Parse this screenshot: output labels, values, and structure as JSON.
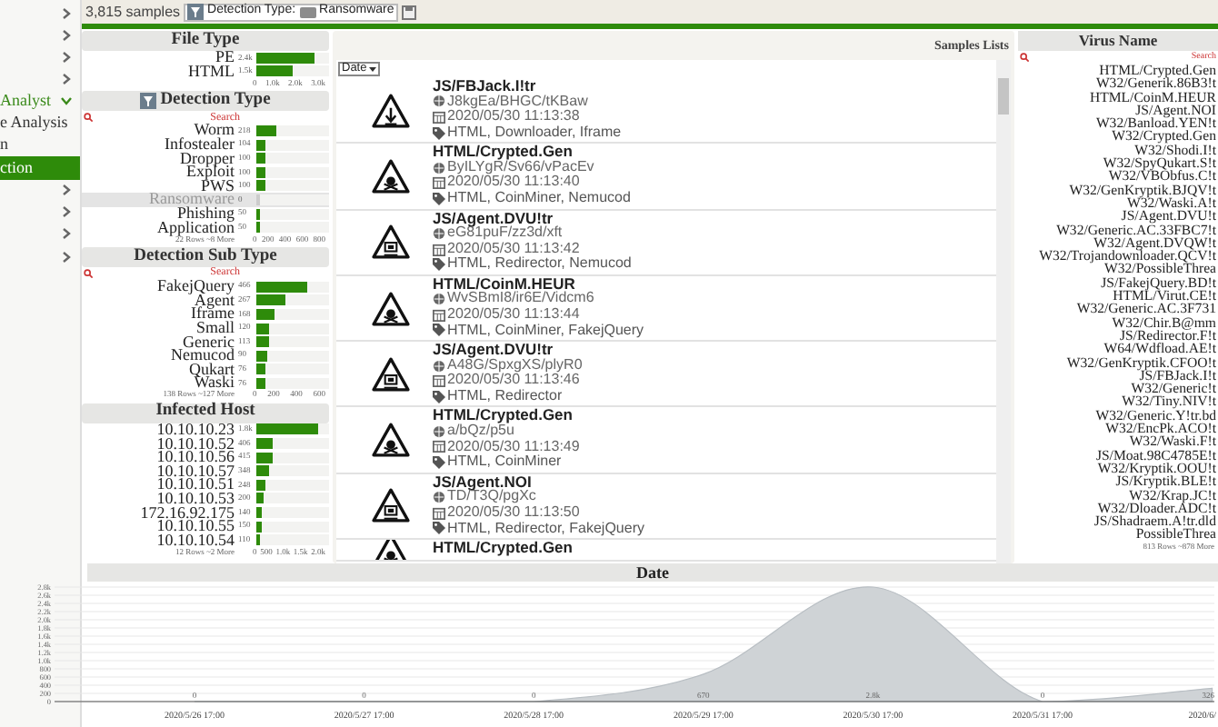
{
  "sidebar": {
    "items": [
      {
        "selected": false
      },
      {
        "selected": false
      },
      {
        "selected": false
      },
      {
        "selected": false
      },
      {
        "label": "Analyst",
        "expanded": true,
        "selected": false
      },
      {
        "label": "e Analysis",
        "selected": false
      },
      {
        "label": "n",
        "selected": false
      },
      {
        "label": "ction",
        "selected": true
      },
      {
        "selected": false
      },
      {
        "selected": false
      },
      {
        "selected": false
      },
      {
        "selected": false
      }
    ]
  },
  "toolbar": {
    "count": "3,815 samples",
    "filter": {
      "label": "Detection Type:",
      "value": "Ransomware"
    }
  },
  "facets": [
    {
      "title": "File Type",
      "rows": [
        {
          "label": "PE",
          "reading": "2.4k",
          "level": 0.8
        },
        {
          "label": "HTML",
          "reading": "1.5k",
          "level": 0.5
        }
      ],
      "ticks": [
        "0",
        "1.0k",
        "2.0k",
        "3.0k"
      ]
    },
    {
      "title": "Detection Type",
      "filtered": true,
      "search": "Search",
      "rows": [
        {
          "label": "Worm",
          "reading": "218",
          "level": 0.27,
          "disabled": false
        },
        {
          "label": "Infostealer",
          "reading": "104",
          "level": 0.13,
          "disabled": false
        },
        {
          "label": "Dropper",
          "reading": "100",
          "level": 0.12,
          "disabled": false
        },
        {
          "label": "Exploit",
          "reading": "100",
          "level": 0.12,
          "disabled": false
        },
        {
          "label": "PWS",
          "reading": "100",
          "level": 0.12,
          "disabled": false
        },
        {
          "label": "Ransomware",
          "reading": "0",
          "level": 0.04,
          "disabled": true
        },
        {
          "label": "Phishing",
          "reading": "50",
          "level": 0.06,
          "disabled": false
        },
        {
          "label": "Application",
          "reading": "50",
          "level": 0.06,
          "disabled": false
        }
      ],
      "footer": "22 Rows ~8 More",
      "ticks": [
        "0",
        "200",
        "400",
        "600",
        "800"
      ]
    },
    {
      "title": "Detection Sub Type",
      "search": "Search",
      "rows": [
        {
          "label": "FakejQuery",
          "reading": "466",
          "level": 0.7
        },
        {
          "label": "Agent",
          "reading": "267",
          "level": 0.4
        },
        {
          "label": "Iframe",
          "reading": "168",
          "level": 0.26
        },
        {
          "label": "Small",
          "reading": "120",
          "level": 0.18
        },
        {
          "label": "Generic",
          "reading": "113",
          "level": 0.17
        },
        {
          "label": "Nemucod",
          "reading": "90",
          "level": 0.14
        },
        {
          "label": "Qukart",
          "reading": "76",
          "level": 0.12
        },
        {
          "label": "Waski",
          "reading": "76",
          "level": 0.12
        }
      ],
      "footer": "138 Rows ~127 More",
      "ticks": [
        "0",
        "200",
        "400",
        "600"
      ]
    },
    {
      "title": "Infected Host",
      "rows": [
        {
          "label": "10.10.10.23",
          "reading": "1.8k",
          "level": 0.85
        },
        {
          "label": "10.10.10.52",
          "reading": "406",
          "level": 0.22
        },
        {
          "label": "10.10.10.56",
          "reading": "415",
          "level": 0.22
        },
        {
          "label": "10.10.10.57",
          "reading": "348",
          "level": 0.18
        },
        {
          "label": "10.10.10.51",
          "reading": "248",
          "level": 0.13
        },
        {
          "label": "10.10.10.53",
          "reading": "200",
          "level": 0.11
        },
        {
          "label": "172.16.92.175",
          "reading": "140",
          "level": 0.08
        },
        {
          "label": "10.10.10.55",
          "reading": "150",
          "level": 0.08
        },
        {
          "label": "10.10.10.54",
          "reading": "110",
          "level": 0.06
        }
      ],
      "footer": "12 Rows ~2 More",
      "ticks": [
        "0",
        "500",
        "1.0k",
        "1.5k",
        "2.0k"
      ]
    }
  ],
  "samples": {
    "title": "Samples Lists",
    "sort": "Date",
    "items": [
      {
        "kind": "download",
        "name": "JS/FBJack.I!tr",
        "url": "J8kgEa/BHGC/tKBaw",
        "date": "2020/05/30 11:13:38",
        "tags": "HTML, Downloader, Iframe"
      },
      {
        "kind": "skull",
        "name": "HTML/Crypted.Gen",
        "url": "ByILYgR/Sv66/vPacEv",
        "date": "2020/05/30 11:13:40",
        "tags": "HTML, CoinMiner, Nemucod"
      },
      {
        "kind": "screen",
        "name": "JS/Agent.DVU!tr",
        "url": "eG81puF/zz3d/xft",
        "date": "2020/05/30 11:13:42",
        "tags": "HTML, Redirector, Nemucod"
      },
      {
        "kind": "skull",
        "name": "HTML/CoinM.HEUR",
        "url": "WvSBmI8/ir6E/Vidcm6",
        "date": "2020/05/30 11:13:44",
        "tags": "HTML, CoinMiner, FakejQuery"
      },
      {
        "kind": "screen",
        "name": "JS/Agent.DVU!tr",
        "url": "A48G/SpxgXS/plyR0",
        "date": "2020/05/30 11:13:46",
        "tags": "HTML, Redirector"
      },
      {
        "kind": "skull",
        "name": "HTML/Crypted.Gen",
        "url": "a/bQz/p5u",
        "date": "2020/05/30 11:13:49",
        "tags": "HTML, CoinMiner"
      },
      {
        "kind": "screen",
        "name": "JS/Agent.NOI",
        "url": "TD/T3Q/pgXc",
        "date": "2020/05/30 11:13:50",
        "tags": "HTML, Redirector, FakejQuery"
      },
      {
        "kind": "skull",
        "name": "HTML/Crypted.Gen"
      }
    ]
  },
  "virus_names": {
    "title": "Virus Name",
    "search": "Search",
    "items": [
      "HTML/Crypted.Gen",
      "W32/Generik.86B3!t",
      "HTML/CoinM.HEUR",
      "JS/Agent.NOI",
      "W32/Banload.YEN!t",
      "W32/Crypted.Gen",
      "W32/Shodi.I!t",
      "W32/SpyQukart.S!t",
      "W32/VBObfus.C!t",
      "W32/GenKryptik.BJQV!t",
      "W32/Waski.A!t",
      "JS/Agent.DVU!t",
      "W32/Generic.AC.33FBC7!t",
      "W32/Agent.DVQW!t",
      "W32/Trojandownloader.QCV!t",
      "W32/PossibleThrea",
      "JS/FakejQuery.BD!t",
      "HTML/Virut.CE!t",
      "W32/Generic.AC.3F731",
      "W32/Chir.B@mm",
      "JS/Redirector.F!t",
      "W64/Wdfload.AE!t",
      "W32/GenKryptik.CFOO!t",
      "JS/FBJack.I!t",
      "W32/Generic!t",
      "W32/Tiny.NIV!t",
      "W32/Generic.Y!tr.bd",
      "W32/EncPk.ACO!t",
      "W32/Waski.F!t",
      "JS/Moat.98C4785E!t",
      "W32/Kryptik.OOU!t",
      "JS/Kryptik.BLE!t",
      "W32/Krap.JC!t",
      "W32/Dloader.ADC!t",
      "JS/Shadraem.A!tr.dld",
      "PossibleThrea"
    ],
    "footer": "813 Rows ~878 More"
  },
  "date_panel": {
    "title": "Date",
    "chart_data": {
      "type": "area",
      "categories": [
        "2020/5/26 17:00",
        "2020/5/27 17:00",
        "2020/5/28 17:00",
        "2020/5/29 17:00",
        "2020/5/30 17:00",
        "2020/5/31 17:00",
        "2020/6/"
      ],
      "series": [
        {
          "color": "#cfd3d6",
          "values": [
            0,
            0,
            0,
            670,
            2800,
            0,
            326
          ]
        }
      ],
      "value_labels": [
        "0",
        "0",
        "0",
        "670",
        "2.8k",
        "0",
        "326"
      ],
      "ylim": [
        0,
        2800
      ],
      "grid": true,
      "yticks": [
        0,
        {
          "value": 200,
          "label": "200"
        },
        {
          "value": 400,
          "label": "400"
        },
        {
          "value": 600,
          "label": "600"
        },
        {
          "value": 800,
          "label": "800"
        },
        {
          "value": 1000,
          "label": "1.0k"
        },
        {
          "value": 1200,
          "label": "1.2k"
        },
        {
          "value": 1400,
          "label": "1.4k"
        },
        {
          "value": 1600,
          "label": "1.6k"
        },
        {
          "value": 1800,
          "label": "1.8k"
        },
        {
          "value": 2000,
          "label": "2.0k"
        },
        {
          "value": 2200,
          "label": "2.2k"
        },
        {
          "value": 2400,
          "label": "2.4k"
        },
        {
          "value": 2600,
          "label": "2.6k"
        },
        {
          "value": 2800,
          "label": "2.8k"
        }
      ]
    }
  }
}
